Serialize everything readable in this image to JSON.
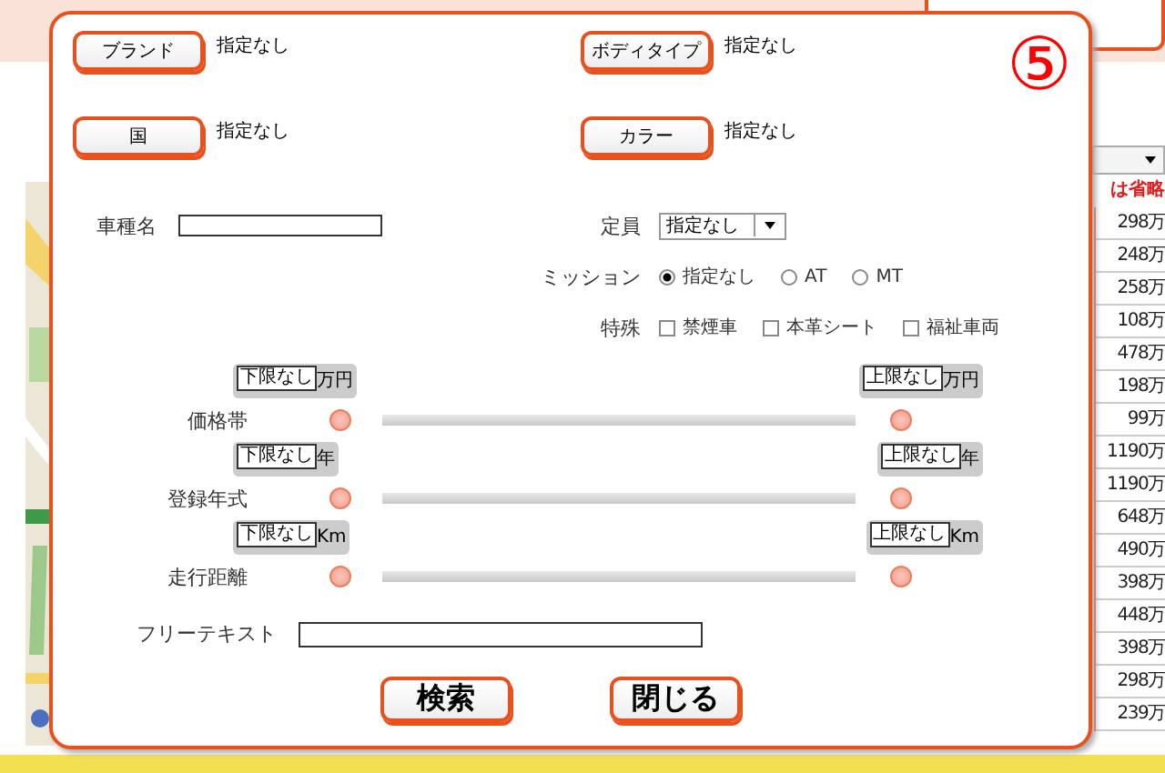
{
  "background": {
    "notice": "は省略",
    "prices": [
      "298万",
      "248万",
      "258万",
      "108万",
      "478万",
      "198万",
      "99万",
      "1190万",
      "1190万",
      "648万",
      "490万",
      "398万",
      "448万",
      "398万",
      "298万",
      "239万"
    ]
  },
  "dialog": {
    "annotation": "⑤",
    "selectors": [
      {
        "button": "ブランド",
        "value": "指定なし"
      },
      {
        "button": "ボディタイプ",
        "value": "指定なし"
      },
      {
        "button": "国",
        "value": "指定なし"
      },
      {
        "button": "カラー",
        "value": "指定なし"
      }
    ],
    "car_name": {
      "label": "車種名"
    },
    "capacity": {
      "label": "定員",
      "value": "指定なし"
    },
    "transmission": {
      "label": "ミッション",
      "options": [
        {
          "label": "指定なし",
          "selected": true
        },
        {
          "label": "AT",
          "selected": false
        },
        {
          "label": "MT",
          "selected": false
        }
      ]
    },
    "special": {
      "label": "特殊",
      "options": [
        {
          "label": "禁煙車",
          "checked": false
        },
        {
          "label": "本革シート",
          "checked": false
        },
        {
          "label": "福祉車両",
          "checked": false
        }
      ]
    },
    "ranges": [
      {
        "label": "価格帯",
        "min": "下限なし",
        "min_unit": "万円",
        "max": "上限なし",
        "max_unit": "万円"
      },
      {
        "label": "登録年式",
        "min": "下限なし",
        "min_unit": "年",
        "max": "上限なし",
        "max_unit": "年"
      },
      {
        "label": "走行距離",
        "min": "下限なし",
        "min_unit": "Km",
        "max": "上限なし",
        "max_unit": "Km"
      }
    ],
    "free_text": {
      "label": "フリーテキスト"
    },
    "buttons": [
      "検索",
      "閉じる"
    ]
  }
}
